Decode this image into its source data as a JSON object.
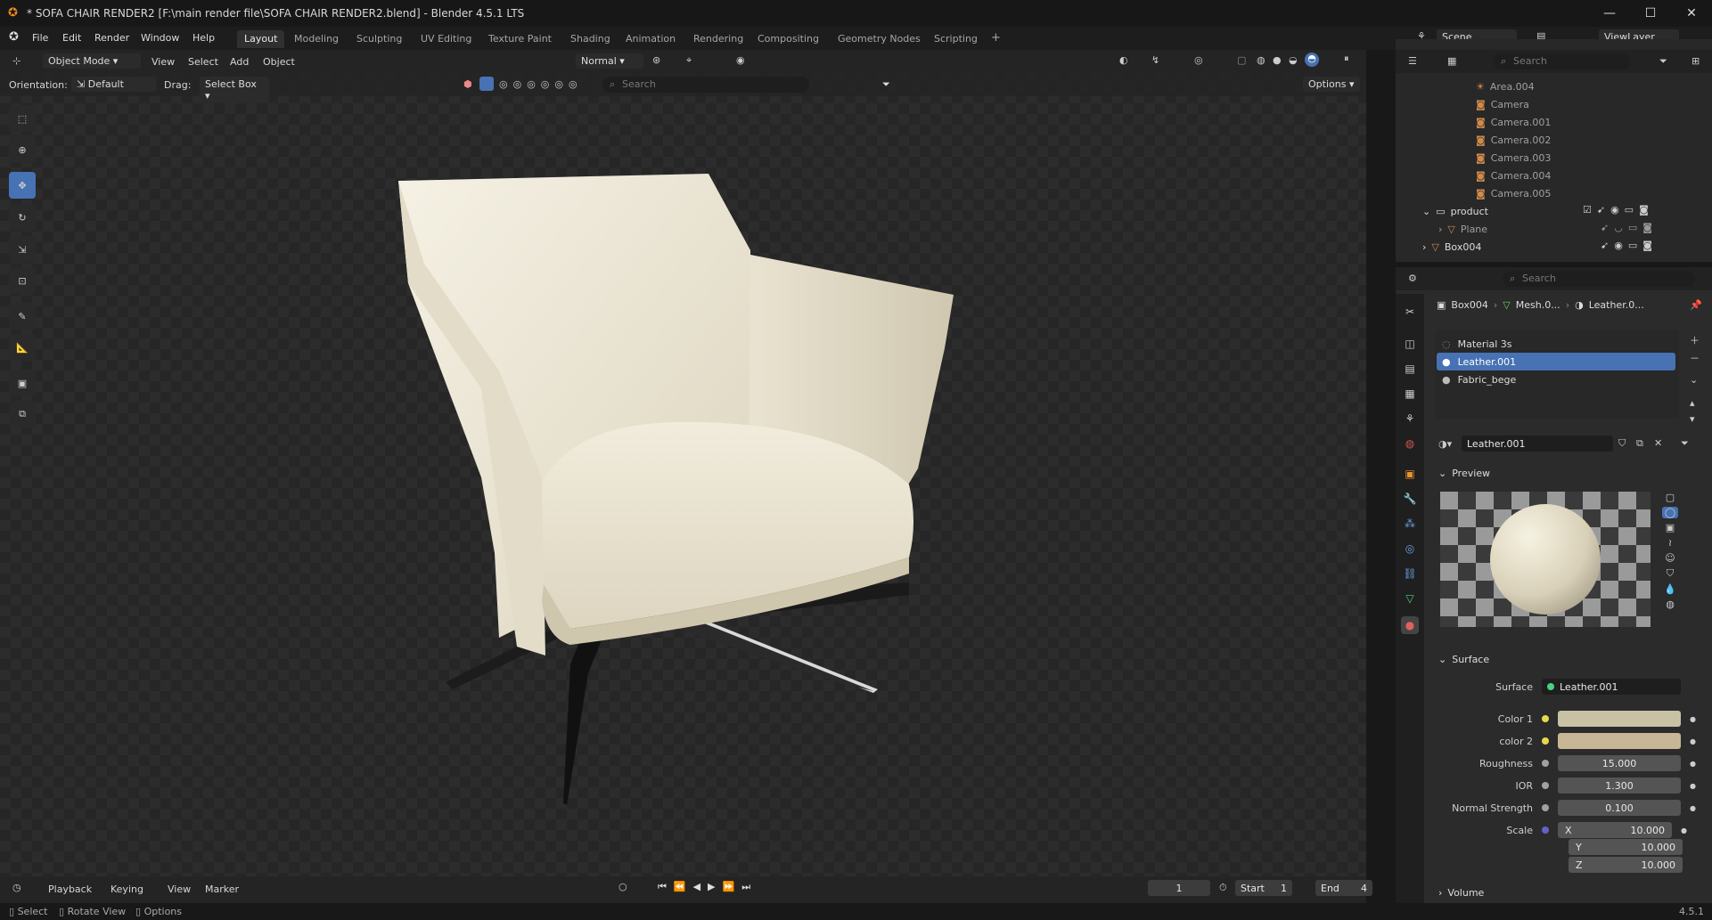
{
  "window": {
    "title": "* SOFA CHAIR  RENDER2 [F:\\main render file\\SOFA CHAIR  RENDER2.blend] - Blender 4.5.1 LTS",
    "minimize": "—",
    "maximize": "☐",
    "close": "✕"
  },
  "menu": [
    "File",
    "Edit",
    "Render",
    "Window",
    "Help"
  ],
  "workspaces": [
    "Layout",
    "Modeling",
    "Sculpting",
    "UV Editing",
    "Texture Paint",
    "Shading",
    "Animation",
    "Rendering",
    "Compositing",
    "Geometry Nodes",
    "Scripting",
    "+"
  ],
  "scene": {
    "label": "Scene",
    "viewlayer": "ViewLayer"
  },
  "viewport_header": {
    "mode": "Object Mode",
    "menus": [
      "View",
      "Select",
      "Add",
      "Object"
    ],
    "orientation_label": "Orientation:",
    "orientation_value": "Default",
    "drag_label": "Drag:",
    "drag_value": "Select Box",
    "transform": "Normal",
    "search_placeholder": "Search",
    "options": "Options"
  },
  "outliner": {
    "search_placeholder": "Search",
    "items": [
      {
        "name": "Area.004",
        "indent": 1
      },
      {
        "name": "Camera",
        "indent": 1
      },
      {
        "name": "Camera.001",
        "indent": 1
      },
      {
        "name": "Camera.002",
        "indent": 1
      },
      {
        "name": "Camera.003",
        "indent": 1
      },
      {
        "name": "Camera.004",
        "indent": 1
      },
      {
        "name": "Camera.005",
        "indent": 1
      },
      {
        "name": "product",
        "indent": 0
      },
      {
        "name": "Plane",
        "indent": 1
      },
      {
        "name": "Box004",
        "indent": 0
      }
    ]
  },
  "properties": {
    "search_placeholder": "Search",
    "breadcrumb": [
      "Box004",
      "Mesh.0...",
      "Leather.0..."
    ],
    "material_slots": [
      "Material 3s",
      "Leather.001",
      "Fabric_bege"
    ],
    "selected_slot": "Leather.001",
    "material_name": "Leather.001",
    "preview_label": "Preview",
    "surface_section": "Surface",
    "surface_label": "Surface",
    "surface_value": "Leather.001",
    "color1_label": "Color 1",
    "color1": "#c9c1a4",
    "color2_label": "color 2",
    "color2": "#c7b797",
    "roughness_label": "Roughness",
    "roughness": "15.000",
    "ior_label": "IOR",
    "ior": "1.300",
    "normal_label": "Normal Strength",
    "normal": "0.100",
    "scale_label": "Scale",
    "scale_x_label": "X",
    "scale_x": "10.000",
    "scale_y_label": "Y",
    "scale_y": "10.000",
    "scale_z_label": "Z",
    "scale_z": "10.000",
    "volume_section": "Volume"
  },
  "timeline": {
    "playback": "Playback",
    "keying": "Keying",
    "view": "View",
    "marker": "Marker",
    "current_frame": "1",
    "start_label": "Start",
    "start": "1",
    "end_label": "End",
    "end": "4"
  },
  "status": {
    "select": "Select",
    "rotate": "Rotate View",
    "options": "Options",
    "version": "4.5.1"
  }
}
